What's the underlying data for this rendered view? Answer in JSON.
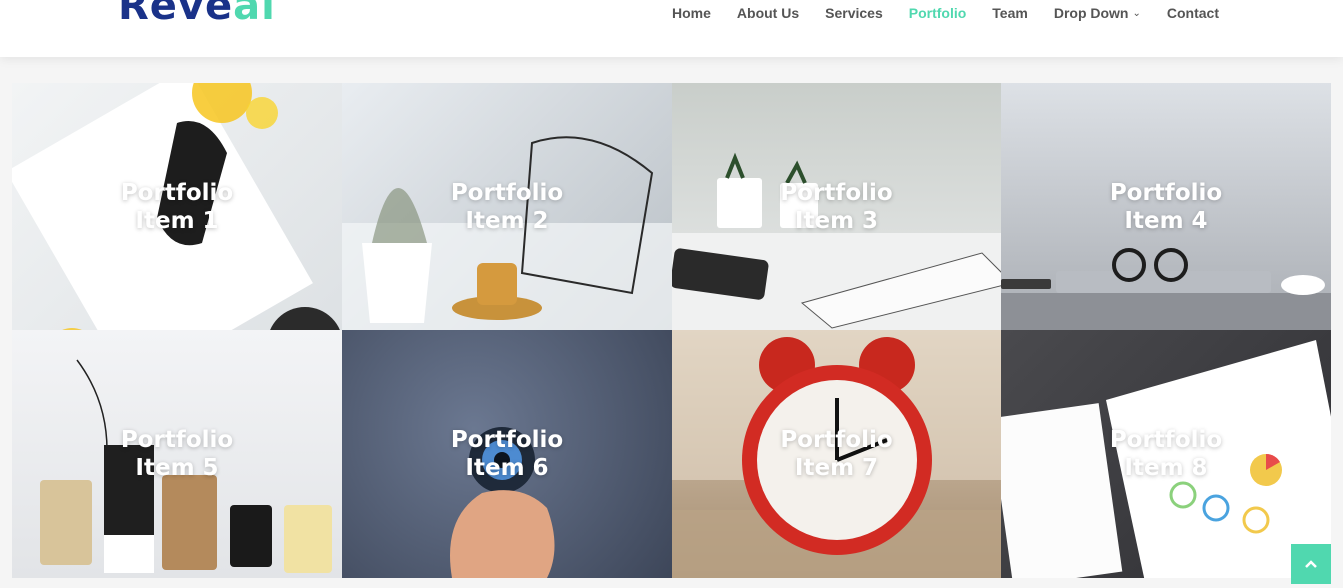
{
  "header": {
    "logo_main": "Reve",
    "logo_accent": "al",
    "nav": [
      {
        "label": "Home"
      },
      {
        "label": "About Us"
      },
      {
        "label": "Services"
      },
      {
        "label": "Portfolio",
        "active": true
      },
      {
        "label": "Team"
      },
      {
        "label": "Drop Down",
        "dropdown": true
      },
      {
        "label": "Contact"
      }
    ]
  },
  "portfolio": {
    "items": [
      {
        "line1": "Portfolio",
        "line2": "Item 1"
      },
      {
        "line1": "Portfolio",
        "line2": "Item 2"
      },
      {
        "line1": "Portfolio",
        "line2": "Item 3"
      },
      {
        "line1": "Portfolio",
        "line2": "Item 4"
      },
      {
        "line1": "Portfolio",
        "line2": "Item 5"
      },
      {
        "line1": "Portfolio",
        "line2": "Item 6"
      },
      {
        "line1": "Portfolio",
        "line2": "Item 7"
      },
      {
        "line1": "Portfolio",
        "line2": "Item 8"
      }
    ]
  },
  "colors": {
    "accent": "#50d8af",
    "brand": "#1a3289",
    "nav_text": "#555555"
  },
  "icons": {
    "back_to_top": "chevron-up-icon",
    "dropdown": "chevron-down-icon"
  }
}
